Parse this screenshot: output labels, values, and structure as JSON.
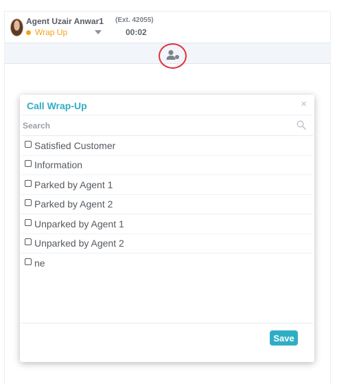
{
  "agent": {
    "name": "Agent Uzair Anwar1",
    "status": "Wrap Up",
    "extension": "(Ext. 42055)",
    "timer": "00:02"
  },
  "colors": {
    "accent": "#2eaec4",
    "status": "#f3a21a",
    "highlight": "#e03038"
  },
  "icons": {
    "toolbar": "agent-user-icon",
    "search": "search-icon",
    "close": "close-icon"
  },
  "modal": {
    "title": "Call Wrap-Up",
    "close_label": "×",
    "search_placeholder": "Search",
    "options": [
      "Satisfied Customer",
      "Information",
      "Parked by Agent 1",
      "Parked by Agent 2",
      "Unparked by Agent 1",
      "Unparked by Agent 2",
      "ne"
    ],
    "save_label": "Save"
  }
}
